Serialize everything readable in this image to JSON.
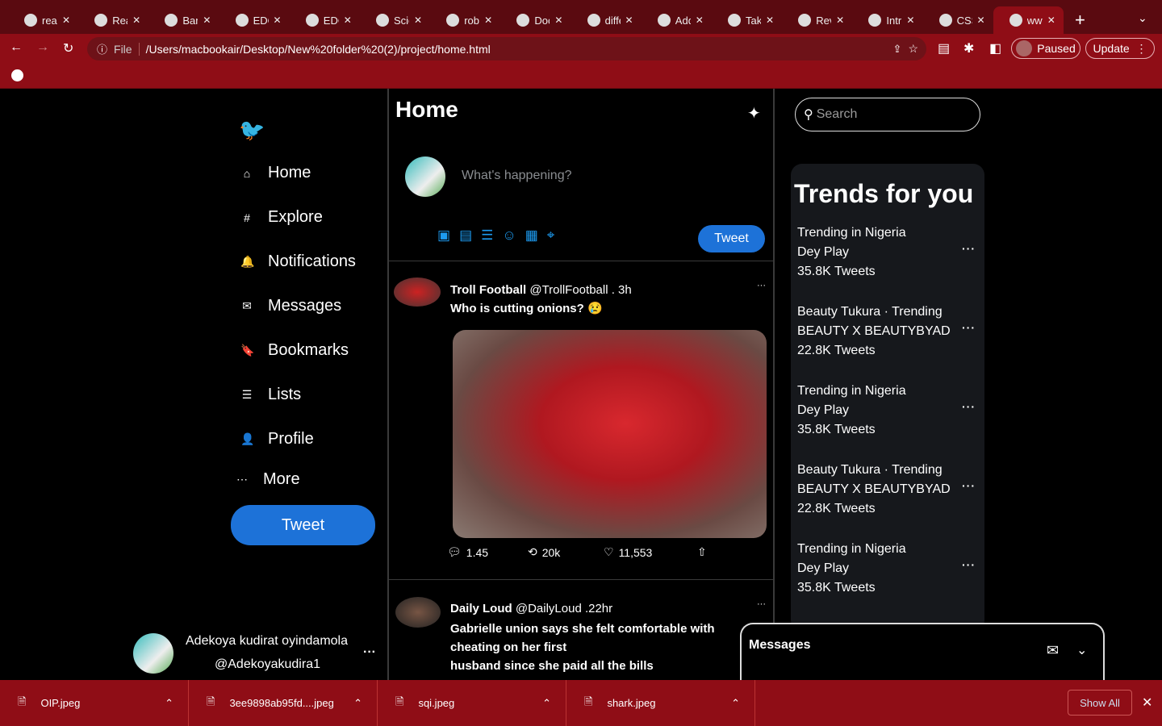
{
  "browser": {
    "tabs": [
      "reac",
      "Reac",
      "Banl",
      "EDO",
      "EDO",
      "Scie",
      "robo",
      "Doc",
      "diffe",
      "Add",
      "Take",
      "Rev",
      "Intro",
      "CSS",
      "www"
    ],
    "url_prefix": "File",
    "url": "/Users/macbookair/Desktop/New%20folder%20(2)/project/home.html",
    "paused_label": "Paused",
    "update_label": "Update"
  },
  "sidebar": {
    "items": [
      {
        "label": "Home",
        "icon": "⌂"
      },
      {
        "label": "Explore",
        "icon": "#"
      },
      {
        "label": "Notifications",
        "icon": "🔔"
      },
      {
        "label": "Messages",
        "icon": "✉"
      },
      {
        "label": "Bookmarks",
        "icon": "🔖"
      },
      {
        "label": "Lists",
        "icon": "☰"
      },
      {
        "label": "Profile",
        "icon": "👤"
      },
      {
        "label": "More",
        "icon": "⋯"
      }
    ],
    "tweet_button": "Tweet",
    "user": {
      "name": "Adekoya kudirat oyindamola",
      "handle": "@Adekoyakudira1"
    }
  },
  "feed": {
    "title": "Home",
    "compose_placeholder": "What's happening?",
    "tweet_button": "Tweet",
    "tweets": [
      {
        "name": "Troll Football",
        "handle": "@TrollFootball . 3h",
        "text": "Who is cutting onions? 😢",
        "replies": "1.45",
        "retweets": "20k",
        "likes": "11,553"
      },
      {
        "name": "Daily Loud",
        "handle": "@DailyLoud .22hr",
        "text_lines": [
          "Gabrielle union says she felt comfortable with",
          "cheating on her first",
          "husband since she paid all the bills"
        ]
      }
    ]
  },
  "right": {
    "search_placeholder": "Search",
    "trends_title": "Trends for you",
    "trends": [
      {
        "context": "Trending in Nigeria",
        "name": "Dey Play",
        "count": "35.8K Tweets"
      },
      {
        "context": "Beauty Tukura · Trending",
        "name": "BEAUTY X BEAUTYBYAD",
        "count": "22.8K Tweets"
      },
      {
        "context": "Trending in Nigeria",
        "name": "Dey Play",
        "count": "35.8K Tweets"
      },
      {
        "context": "Beauty Tukura · Trending",
        "name": "BEAUTY X BEAUTYBYAD",
        "count": "22.8K Tweets"
      },
      {
        "context": "Trending in Nigeria",
        "name": "Dey Play",
        "count": "35.8K Tweets"
      }
    ],
    "messages_title": "Messages"
  },
  "downloads": {
    "files": [
      "OIP.jpeg",
      "3ee9898ab95fd....jpeg",
      "sqi.jpeg",
      "shark.jpeg"
    ],
    "show_all": "Show All"
  },
  "colors": {
    "accent": "#1d72d8",
    "chrome": "#8f0d16",
    "tabbar": "#5a0a10"
  }
}
